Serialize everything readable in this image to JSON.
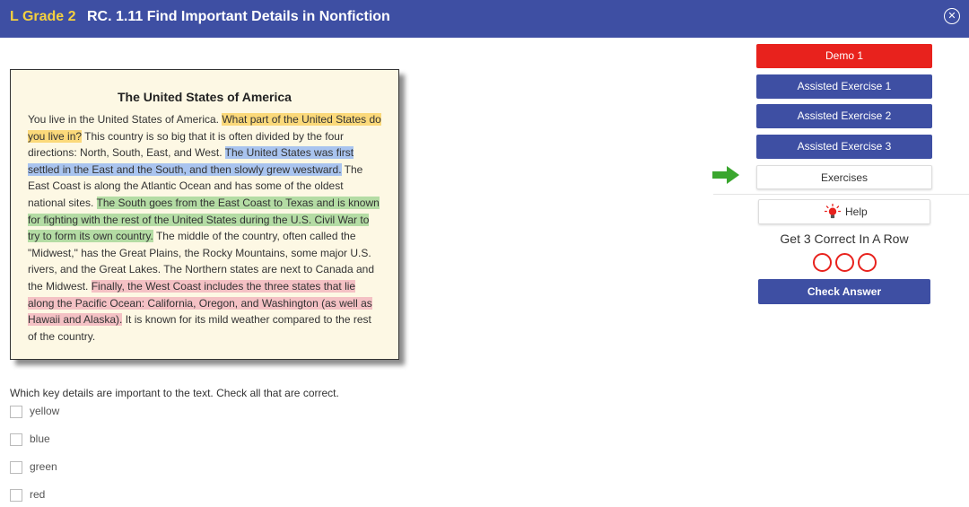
{
  "header": {
    "grade_letter": "L",
    "grade_label": "Grade 2",
    "lesson_title": "RC. 1.11 Find Important Details in Nonfiction",
    "close_glyph": "✕",
    "background": "#3e4fa3"
  },
  "passage": {
    "title": "The United States of America",
    "segments": [
      {
        "text": "You live in the United States of America. ",
        "highlight": ""
      },
      {
        "text": "What part of the United States do you live in?",
        "highlight": "yellow"
      },
      {
        "text": " This country is so big that it is often divided by the four directions: North, South, East, and West. ",
        "highlight": ""
      },
      {
        "text": "The United States was first settled in the East and the South, and then slowly grew westward.",
        "highlight": "blue"
      },
      {
        "text": " The East Coast is along the Atlantic Ocean and has some of the oldest national sites. ",
        "highlight": ""
      },
      {
        "text": "The South goes from the East Coast to Texas and is known for fighting with the rest of the United States during the U.S. Civil War to try to form its own country.",
        "highlight": "green"
      },
      {
        "text": " The middle of the country, often called the \"Midwest,\" has the Great Plains, the Rocky Mountains, some major U.S. rivers, and the Great Lakes. The Northern states are next to Canada and the Midwest. ",
        "highlight": ""
      },
      {
        "text": "Finally, the West Coast includes the three states that lie along the Pacific Ocean: California, Oregon, and Washington (as well as Hawaii and Alaska).",
        "highlight": "red"
      },
      {
        "text": " It is known for its mild weather compared to the rest of the country.",
        "highlight": ""
      }
    ],
    "highlight_colors": {
      "yellow": "#fbd97a",
      "blue": "#a9c4ef",
      "green": "#b4dca4",
      "red": "#f4c1c4"
    }
  },
  "question": {
    "prompt": "Which key details are important to the text. Check all that are correct.",
    "options": [
      {
        "label": "yellow",
        "checked": false
      },
      {
        "label": "blue",
        "checked": false
      },
      {
        "label": "green",
        "checked": false
      },
      {
        "label": "red",
        "checked": false
      }
    ]
  },
  "nav": {
    "demo": "Demo 1",
    "assisted": [
      "Assisted Exercise 1",
      "Assisted Exercise 2",
      "Assisted Exercise 3"
    ],
    "exercises": "Exercises",
    "current": "Exercises",
    "arrow_icon": "arrow-right-icon",
    "arrow_color": "#3aa62e",
    "demo_color": "#e8221d"
  },
  "help": {
    "label": "Help",
    "icon": "lightbulb-icon"
  },
  "streak": {
    "label": "Get 3 Correct In A Row",
    "correct": 0,
    "total": 3
  },
  "check_answer": "Check Answer"
}
